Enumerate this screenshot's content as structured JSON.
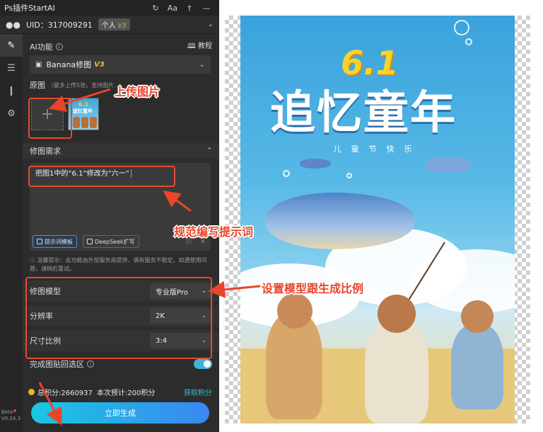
{
  "titlebar": {
    "title": "Ps插件StartAI",
    "font_icon": "Aa"
  },
  "user": {
    "uid_text": "UID：317009291",
    "plan": "个人",
    "plan_level": "V3"
  },
  "ai": {
    "label": "AI功能",
    "tutorial": "教程",
    "func_name": "Banana修图",
    "func_badge": "V3"
  },
  "original": {
    "label": "原图",
    "hint": "（最多上传5张，支持图片...",
    "upload_symbol": "+"
  },
  "thumb": {
    "small_61": "6.1",
    "small_title": "追忆童年"
  },
  "prompt": {
    "section_title": "修图需求",
    "text": "把图1中的“6.1”修改为“六一”",
    "template_btn": "提示词模板",
    "deepseek_btn": "DeepSeek扩写"
  },
  "notice": "温馨提示：此功能由外部服务商提供，偶有服务不稳定，如遇使用问题，请稍后重试。",
  "settings": [
    {
      "label": "修图模型",
      "value": "专业版Pro"
    },
    {
      "label": "分辨率",
      "value": "2K"
    },
    {
      "label": "尺寸比例",
      "value": "3:4"
    }
  ],
  "toggle": {
    "label": "完成图贴回选区",
    "on": true
  },
  "points": {
    "total": "总积分:2660937",
    "estimate": "本次预计:200积分",
    "earn": "获取积分"
  },
  "generate": {
    "label": "立即生成"
  },
  "beta": {
    "label": "Beta",
    "version": "V0.24.3"
  },
  "poster": {
    "number": "6.1",
    "title": "追忆童年",
    "subtitle": "儿童节快乐"
  },
  "annotations": {
    "upload": "上传图片",
    "prompt": "规范编写提示词",
    "settings": "设置模型跟生成比例"
  },
  "colors": {
    "accent": "#e9452a",
    "brand_gradient_start": "#19c8e0",
    "brand_gradient_end": "#3a87f2",
    "toggle": "#3fb5d6",
    "badge_gold": "#e7b93b"
  }
}
